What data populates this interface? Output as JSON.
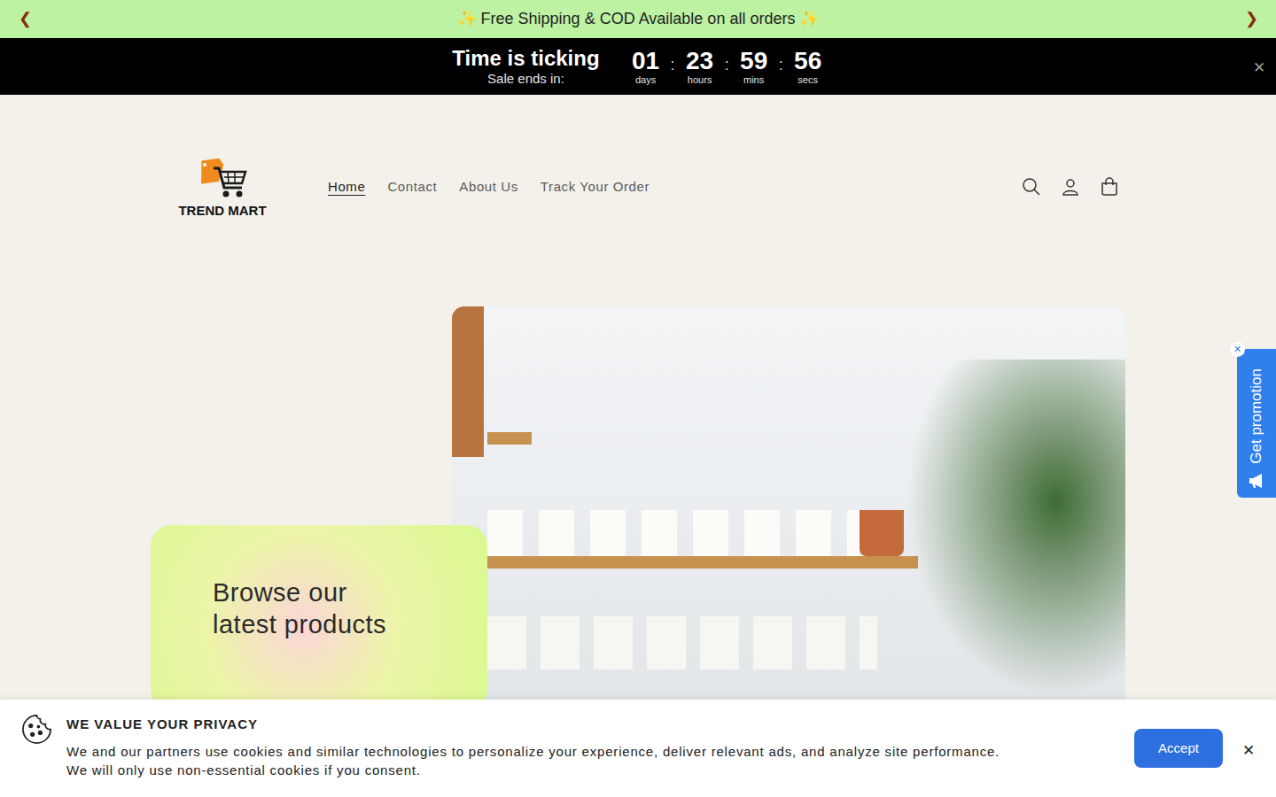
{
  "announcement": {
    "prev": "❮",
    "text": "✨ Free Shipping & COD Available on all orders ✨",
    "next": "❯"
  },
  "countdown": {
    "title": "Time is ticking",
    "subtitle": "Sale ends in:",
    "separator": ":",
    "close": "✕",
    "units": [
      {
        "value": "01",
        "label": "days"
      },
      {
        "value": "23",
        "label": "hours"
      },
      {
        "value": "59",
        "label": "mins"
      },
      {
        "value": "56",
        "label": "secs"
      }
    ]
  },
  "header": {
    "logo": "TREND MART",
    "nav": [
      {
        "label": "Home",
        "selected": true
      },
      {
        "label": "Contact",
        "selected": false
      },
      {
        "label": "About Us",
        "selected": false
      },
      {
        "label": "Track Your Order",
        "selected": false
      }
    ]
  },
  "hero": {
    "heading_lines": [
      "Browse our",
      "latest products"
    ]
  },
  "promotion": {
    "label": "Get promotion",
    "close": "✕"
  },
  "cookie": {
    "title": "WE VALUE YOUR PRIVACY",
    "lines": [
      "We and our partners use cookies and similar technologies to personalize your experience, deliver relevant ads, and analyze site performance.",
      "We will only use non-essential cookies if you consent."
    ],
    "accept": "Accept",
    "close": "✕"
  }
}
